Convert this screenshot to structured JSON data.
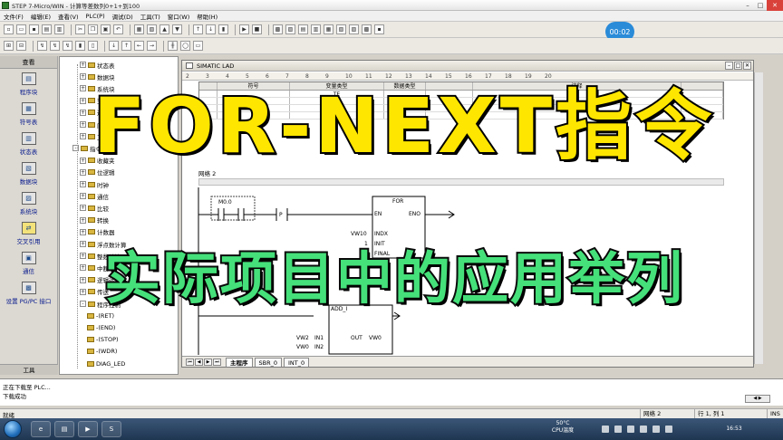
{
  "window": {
    "title": "STEP 7-Micro/WIN - 计算等差数列0+1+到100",
    "buttons": {
      "minimize": "–",
      "maximize": "□",
      "close": "✕"
    }
  },
  "menu": [
    "文件(F)",
    "编辑(E)",
    "查看(V)",
    "PLC(P)",
    "调试(D)",
    "工具(T)",
    "窗口(W)",
    "帮助(H)"
  ],
  "timer": "00:02",
  "left_nav": {
    "header": "查看",
    "items": [
      "程序块",
      "符号表",
      "状态表",
      "数据块",
      "系统块",
      "交叉引用",
      "通信",
      "设置 PG/PC 接口"
    ],
    "footer": "工具"
  },
  "tree": [
    {
      "label": "状态表",
      "indent": 1,
      "exp": "+"
    },
    {
      "label": "数据块",
      "indent": 1,
      "exp": "+"
    },
    {
      "label": "系统块",
      "indent": 1,
      "exp": "+"
    },
    {
      "label": "交叉引用",
      "indent": 1,
      "exp": "+"
    },
    {
      "label": "通信",
      "indent": 1,
      "exp": "+"
    },
    {
      "label": "向导",
      "indent": 1,
      "exp": "+"
    },
    {
      "label": "工具",
      "indent": 1,
      "exp": "+"
    },
    {
      "label": "指令",
      "indent": 0,
      "exp": "-"
    },
    {
      "label": "收藏夹",
      "indent": 1,
      "exp": "+"
    },
    {
      "label": "位逻辑",
      "indent": 1,
      "exp": "+"
    },
    {
      "label": "时钟",
      "indent": 1,
      "exp": "+"
    },
    {
      "label": "通信",
      "indent": 1,
      "exp": "+"
    },
    {
      "label": "比较",
      "indent": 1,
      "exp": "+"
    },
    {
      "label": "转换",
      "indent": 1,
      "exp": "+"
    },
    {
      "label": "计数器",
      "indent": 1,
      "exp": "+"
    },
    {
      "label": "浮点数计算",
      "indent": 1,
      "exp": "+"
    },
    {
      "label": "整数计算",
      "indent": 1,
      "exp": "+"
    },
    {
      "label": "中断",
      "indent": 1,
      "exp": "+"
    },
    {
      "label": "逻辑运算",
      "indent": 1,
      "exp": "+"
    },
    {
      "label": "传送",
      "indent": 1,
      "exp": "+"
    },
    {
      "label": "程序控制",
      "indent": 1,
      "exp": "-"
    },
    {
      "label": "-(RET)",
      "indent": 2,
      "exp": ""
    },
    {
      "label": "-(END)",
      "indent": 2,
      "exp": ""
    },
    {
      "label": "-(STOP)",
      "indent": 2,
      "exp": ""
    },
    {
      "label": "-(WDR)",
      "indent": 2,
      "exp": ""
    },
    {
      "label": "DIAG_LED",
      "indent": 2,
      "exp": ""
    }
  ],
  "lad_window": {
    "title": "SIMATIC LAD",
    "ruler": [
      "2",
      "3",
      "4",
      "5",
      "6",
      "7",
      "8",
      "9",
      "10",
      "11",
      "12",
      "13",
      "14",
      "15",
      "16",
      "17",
      "18",
      "19",
      "20"
    ],
    "symbol_table": {
      "headers": [
        "",
        "符号",
        "变量类型",
        "数据类型",
        "",
        "注释",
        ""
      ],
      "rows": [
        [
          "",
          "",
          "TE",
          "",
          "",
          "",
          ""
        ],
        [
          "",
          "",
          "TE",
          "",
          "",
          "",
          ""
        ],
        [
          "",
          "",
          "TE",
          "",
          "",
          "",
          ""
        ],
        [
          "",
          "",
          "TE",
          "",
          "",
          "",
          ""
        ]
      ]
    },
    "network_label": "网络 2",
    "ladder": {
      "contact_addr": "M0.0",
      "pulse": "P",
      "for_box": {
        "title": "FOR",
        "en": "EN",
        "eno": "ENO",
        "indx": "INDX",
        "init": "INIT",
        "final": "FINAL",
        "indx_operand": "VW10",
        "init_operand": "1"
      },
      "add_box": {
        "title": "ADD_I",
        "in1": "IN1",
        "in2": "IN2",
        "out": "OUT",
        "in1_operand": "VW2",
        "in2_operand": "VW0",
        "out_operand": "VW0"
      }
    },
    "tabs": [
      "主程序",
      "SBR_0",
      "INT_0"
    ]
  },
  "output_panel": {
    "line1": "正在下载至 PLC...",
    "line2": "下载成功"
  },
  "status_bar": {
    "left": "就绪",
    "network": "网络 2",
    "position": "行 1, 列 1",
    "mode": "INS"
  },
  "taskbar": {
    "weather": "50°C",
    "weather_sub": "CPU温度",
    "time": "16:53"
  },
  "overlay": {
    "title": "FOR-NEXT指令",
    "subtitle": "实际项目中的应用举列"
  }
}
